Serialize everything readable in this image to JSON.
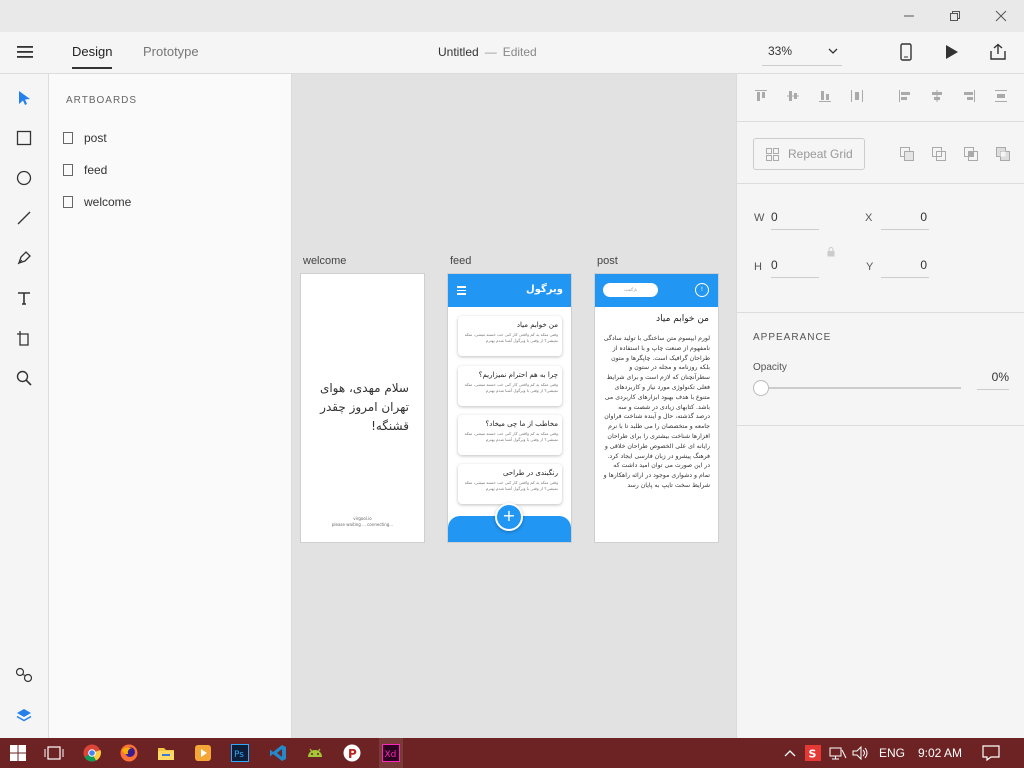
{
  "window": {
    "min_icon": "minimize-icon",
    "restore_icon": "restore-icon",
    "close_icon": "close-icon"
  },
  "header": {
    "tabs": [
      {
        "label": "Design",
        "active": true
      },
      {
        "label": "Prototype",
        "active": false
      }
    ],
    "doc_title": "Untitled",
    "doc_sep": "—",
    "doc_status": "Edited",
    "zoom": "33%"
  },
  "layers": {
    "heading": "ARTBOARDS",
    "items": [
      "post",
      "feed",
      "welcome"
    ]
  },
  "canvas": {
    "welcome": {
      "label": "welcome",
      "greeting": "سلام مهدی، هوای تهران امروز چقدر قشنگه!",
      "footer_line1": "virgool.io",
      "footer_line2": "please waiting ... connecting..."
    },
    "feed": {
      "label": "feed",
      "app_title": "ویرگول",
      "fab": "+",
      "cards": [
        {
          "title": "من خوابم میاد",
          "body": "وقتی متکه یه کم واقعی کار کنی خب خسته میشی، متکه نمیشی؟ از وقتی با ویرگول آشنا شدم بهترم"
        },
        {
          "title": "چرا به هم احترام نمیزاریم؟",
          "body": "وقتی متکه یه کم واقعی کار کنی خب خسته میشی، متکه نمیشی؟ از وقتی با ویرگول آشنا شدم بهترم"
        },
        {
          "title": "مخاطب از ما چی میخاد؟",
          "body": "وقتی متکه یه کم واقعی کار کنی خب خسته میشی، متکه نمیشی؟ از وقتی با ویرگول آشنا شدم بهترم"
        },
        {
          "title": "رنگبندی در طراحی",
          "body": "وقتی متکه یه کم واقعی کار کنی خب خسته میشی، متکه نمیشی؟ از وقتی با ویرگول آشنا شدم بهترم"
        }
      ]
    },
    "post": {
      "label": "post",
      "back_label": "بازگشت",
      "circle_label": "!",
      "title": "من خوابم میاد",
      "body": "لورم ایپسوم متن ساختگی با تولید سادگی نامفهوم از صنعت چاپ و با استفاده از طراحان گرافیک است. چاپگرها و متون بلکه روزنامه و مجله در ستون و سطرآنچنان که لازم است و برای شرایط فعلی تکنولوژی مورد نیاز و کاربردهای متنوع با هدف بهبود ابزارهای کاربردی می باشد. کتابهای زیادی در شصت و سه درصد گذشته، حال و آینده شناخت فراوان جامعه و متخصصان را می طلبد تا با نرم افزارها شناخت بیشتری را برای طراحان رایانه ای علی الخصوص طراحان خلاقی و فرهنگ پیشرو در زبان فارسی ایجاد کرد. در این صورت می توان امید داشت که تمام و دشواری موجود در ارائه راهکارها و شرایط سخت تایپ به پایان رسد"
    }
  },
  "props": {
    "repeat_grid": "Repeat Grid",
    "w_label": "W",
    "w_value": "0",
    "h_label": "H",
    "h_value": "0",
    "x_label": "X",
    "x_value": "0",
    "y_label": "Y",
    "y_value": "0",
    "appearance": "APPEARANCE",
    "opacity_label": "Opacity",
    "opacity_value": "0%"
  },
  "taskbar": {
    "lang": "ENG",
    "time": "9:02 AM"
  },
  "colors": {
    "accent": "#2196f3",
    "taskbar": "#6d2323",
    "xd": "#ff26be"
  }
}
